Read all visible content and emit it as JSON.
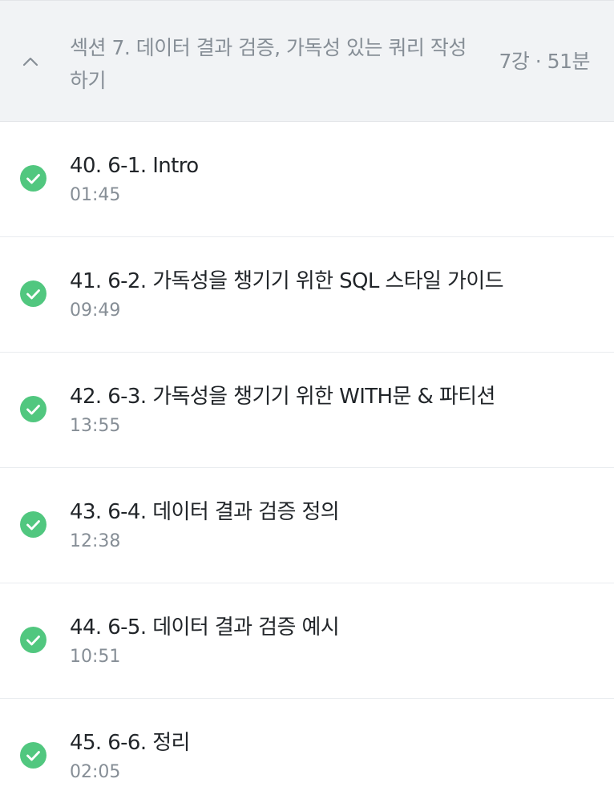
{
  "section": {
    "title": "섹션 7. 데이터 결과 검증, 가독성 있는 쿼리 작성하기",
    "meta": "7강 · 51분",
    "expanded_icon": "chevron-up-icon"
  },
  "colors": {
    "complete": "#51c77f",
    "header_bg": "#f1f3f5",
    "muted_text": "#868e96",
    "title_text": "#212529"
  },
  "lessons": [
    {
      "title": "40. 6-1. Intro",
      "duration": "01:45",
      "status_icon": "check-circle-icon"
    },
    {
      "title": "41. 6-2. 가독성을 챙기기 위한 SQL 스타일 가이드",
      "duration": "09:49",
      "status_icon": "check-circle-icon"
    },
    {
      "title": "42. 6-3. 가독성을 챙기기 위한 WITH문 & 파티션",
      "duration": "13:55",
      "status_icon": "check-circle-icon"
    },
    {
      "title": "43. 6-4. 데이터 결과 검증 정의",
      "duration": "12:38",
      "status_icon": "check-circle-icon"
    },
    {
      "title": "44. 6-5. 데이터 결과 검증 예시",
      "duration": "10:51",
      "status_icon": "check-circle-icon"
    },
    {
      "title": "45. 6-6. 정리",
      "duration": "02:05",
      "status_icon": "check-circle-icon"
    }
  ]
}
